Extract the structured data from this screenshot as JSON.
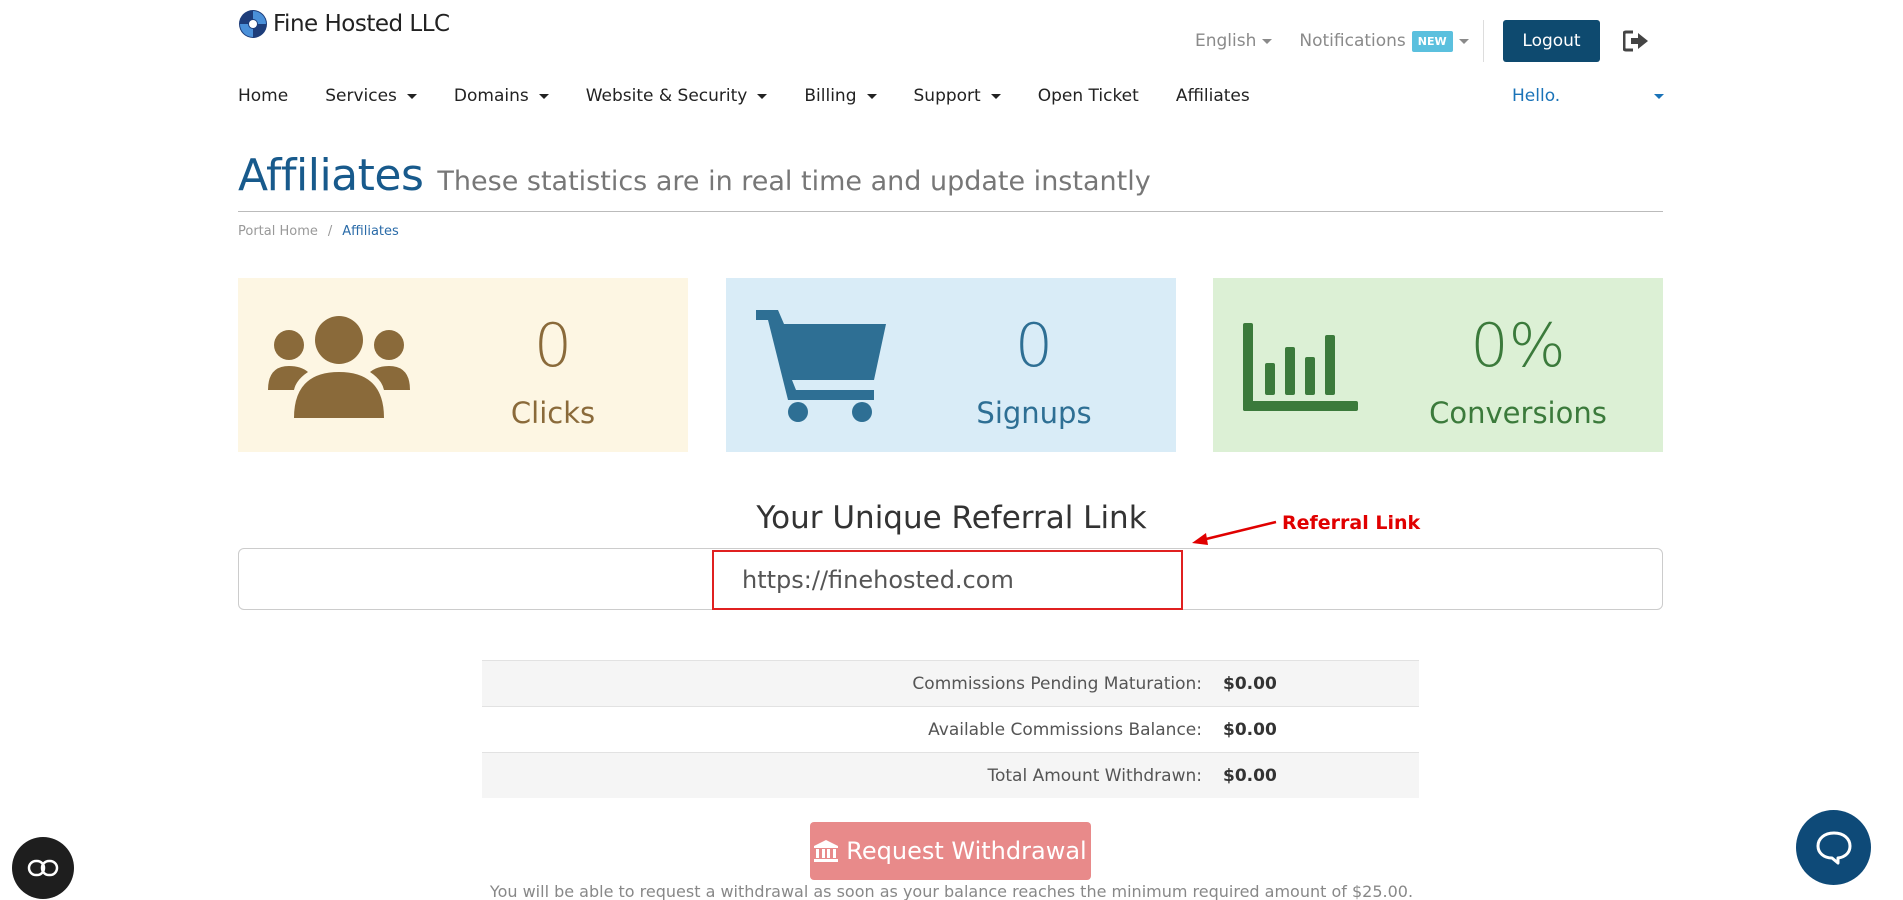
{
  "header": {
    "logo_text": "Fine Hosted LLC",
    "language": "English",
    "notifications_label": "Notifications",
    "notifications_badge": "NEW",
    "logout_label": "Logout"
  },
  "nav": {
    "items": [
      {
        "label": "Home",
        "dropdown": false
      },
      {
        "label": "Services",
        "dropdown": true
      },
      {
        "label": "Domains",
        "dropdown": true
      },
      {
        "label": "Website & Security",
        "dropdown": true
      },
      {
        "label": "Billing",
        "dropdown": true
      },
      {
        "label": "Support",
        "dropdown": true
      },
      {
        "label": "Open Ticket",
        "dropdown": false
      },
      {
        "label": "Affiliates",
        "dropdown": false
      }
    ],
    "user_greeting": "Hello."
  },
  "page": {
    "title": "Affiliates",
    "subtitle": "These statistics are in real time and update instantly",
    "breadcrumb": [
      "Portal Home",
      "Affiliates"
    ]
  },
  "stats": {
    "clicks": {
      "value": "0",
      "label": "Clicks",
      "icon": "users-icon"
    },
    "signups": {
      "value": "0",
      "label": "Signups",
      "icon": "cart-icon"
    },
    "conversions": {
      "value": "0%",
      "label": "Conversions",
      "icon": "bar-chart-icon"
    }
  },
  "referral": {
    "heading": "Your Unique Referral Link",
    "link": "https://finehosted.com",
    "annotation": "Referral Link"
  },
  "commissions": {
    "rows": [
      {
        "label": "Commissions Pending Maturation:",
        "value": "$0.00"
      },
      {
        "label": "Available Commissions Balance:",
        "value": "$0.00"
      },
      {
        "label": "Total Amount Withdrawn:",
        "value": "$0.00"
      }
    ]
  },
  "withdraw": {
    "button_label": "Request Withdrawal",
    "note": "You will be able to request a withdrawal as soon as your balance reaches the minimum required amount of $25.00."
  },
  "colors": {
    "brand": "#0e4a6f",
    "title": "#185a8c",
    "clicks_bg": "#fdf6e3",
    "signups_bg": "#d9ecf7",
    "conversions_bg": "#dcf0d5",
    "annotation": "#e00000",
    "withdraw_btn": "#e88a8a"
  }
}
